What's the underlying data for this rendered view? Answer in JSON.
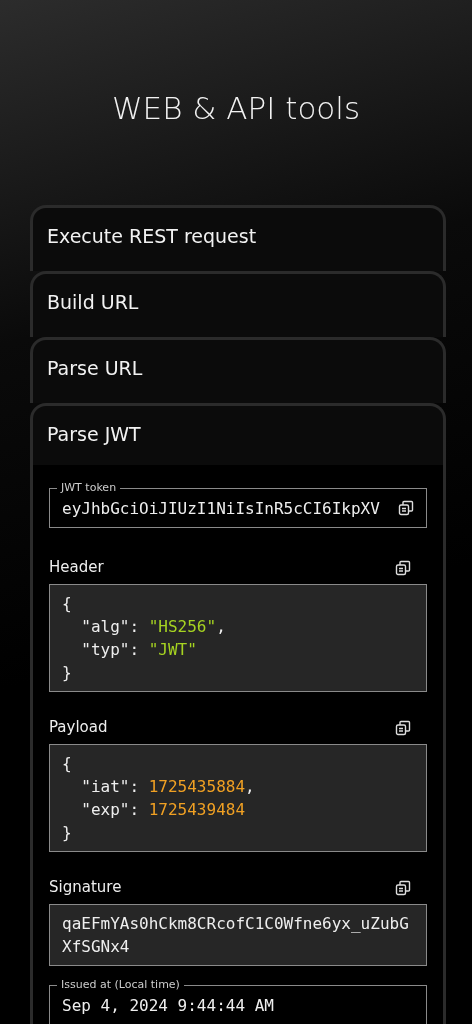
{
  "title": "WEB & API tools",
  "tools": [
    {
      "label": "Execute REST request",
      "expanded": false
    },
    {
      "label": "Build URL",
      "expanded": false
    },
    {
      "label": "Parse URL",
      "expanded": false
    },
    {
      "label": "Parse JWT",
      "expanded": true
    }
  ],
  "jwt": {
    "token": {
      "label": "JWT token",
      "value": "eyJhbGciOiJIUzI1NiIsInR5cCI6IkpXV"
    },
    "sections": [
      {
        "label": "Header",
        "kind": "code",
        "lines": [
          [
            {
              "kind": "punct",
              "text": "{"
            }
          ],
          [
            {
              "kind": "key",
              "text": "  \"alg\": "
            },
            {
              "kind": "string",
              "text": "\"HS256\""
            },
            {
              "kind": "punct",
              "text": ","
            }
          ],
          [
            {
              "kind": "key",
              "text": "  \"typ\": "
            },
            {
              "kind": "string",
              "text": "\"JWT\""
            }
          ],
          [
            {
              "kind": "punct",
              "text": "}"
            }
          ]
        ]
      },
      {
        "label": "Payload",
        "kind": "code",
        "lines": [
          [
            {
              "kind": "punct",
              "text": "{"
            }
          ],
          [
            {
              "kind": "key",
              "text": "  \"iat\": "
            },
            {
              "kind": "number",
              "text": "1725435884"
            },
            {
              "kind": "punct",
              "text": ","
            }
          ],
          [
            {
              "kind": "key",
              "text": "  \"exp\": "
            },
            {
              "kind": "number",
              "text": "1725439484"
            }
          ],
          [
            {
              "kind": "punct",
              "text": "}"
            }
          ]
        ]
      },
      {
        "label": "Signature",
        "kind": "text",
        "value": "qaEFmYAs0hCkm8CRcofC1C0Wfne6yx_uZubGXfSGNx4"
      }
    ],
    "issued": {
      "label": "Issued at (Local time)",
      "value": "Sep 4, 2024 9:44:44 AM"
    }
  }
}
